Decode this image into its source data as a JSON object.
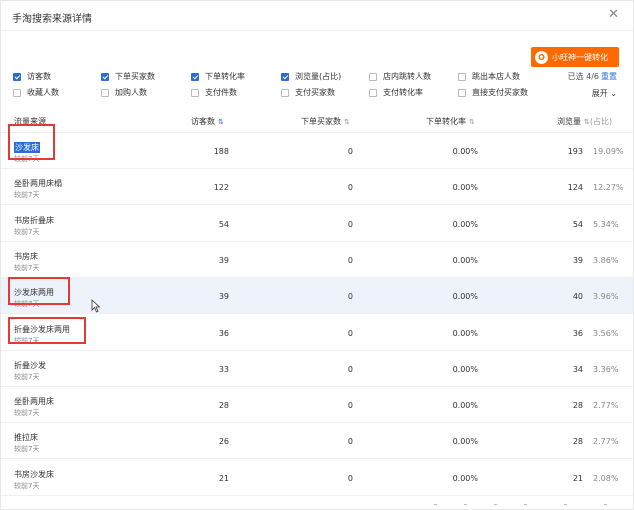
{
  "header": {
    "title": "手淘搜索来源详情",
    "close_icon": "close-icon"
  },
  "promo": {
    "label": "小旺神一键转化",
    "icon_char": "O"
  },
  "options": [
    {
      "label": "访客数",
      "checked": true
    },
    {
      "label": "下单买家数",
      "checked": true
    },
    {
      "label": "下单转化率",
      "checked": true
    },
    {
      "label": "浏览量(占比)",
      "checked": true
    },
    {
      "label": "店内跳转人数",
      "checked": false
    },
    {
      "label": "跳出本店人数",
      "checked": false
    },
    {
      "label": "收藏人数",
      "checked": false
    },
    {
      "label": "加购人数",
      "checked": false
    },
    {
      "label": "支付件数",
      "checked": false
    },
    {
      "label": "支付买家数",
      "checked": false
    },
    {
      "label": "支付转化率",
      "checked": false
    },
    {
      "label": "直接支付买家数",
      "checked": false
    }
  ],
  "selection": {
    "text": "已选 4/6",
    "reset": "重置",
    "expand": "展开"
  },
  "columns": {
    "source": "流量来源",
    "visitors": "访客数",
    "buyers": "下单买家数",
    "conv": "下单转化率",
    "pv": "浏览量",
    "pv_share": "(占比)"
  },
  "rows": [
    {
      "name": "沙发床",
      "sub": "较前7天",
      "visitors": "188",
      "buyers": "0",
      "conv": "0.00%",
      "pv": "193",
      "share": "19.09%"
    },
    {
      "name": "坐卧两用床榻",
      "sub": "较前7天",
      "visitors": "122",
      "buyers": "0",
      "conv": "0.00%",
      "pv": "124",
      "share": "12.27%"
    },
    {
      "name": "书房折叠床",
      "sub": "较前7天",
      "visitors": "54",
      "buyers": "0",
      "conv": "0.00%",
      "pv": "54",
      "share": "5.34%"
    },
    {
      "name": "书房床",
      "sub": "较前7天",
      "visitors": "39",
      "buyers": "0",
      "conv": "0.00%",
      "pv": "39",
      "share": "3.86%"
    },
    {
      "name": "沙发床两用",
      "sub": "较前7天",
      "visitors": "39",
      "buyers": "0",
      "conv": "0.00%",
      "pv": "40",
      "share": "3.96%"
    },
    {
      "name": "折叠沙发床两用",
      "sub": "较前7天",
      "visitors": "36",
      "buyers": "0",
      "conv": "0.00%",
      "pv": "36",
      "share": "3.56%"
    },
    {
      "name": "折叠沙发",
      "sub": "较前7天",
      "visitors": "33",
      "buyers": "0",
      "conv": "0.00%",
      "pv": "34",
      "share": "3.36%"
    },
    {
      "name": "坐卧两用床",
      "sub": "较前7天",
      "visitors": "28",
      "buyers": "0",
      "conv": "0.00%",
      "pv": "28",
      "share": "2.77%"
    },
    {
      "name": "推拉床",
      "sub": "较前7天",
      "visitors": "26",
      "buyers": "0",
      "conv": "0.00%",
      "pv": "28",
      "share": "2.77%"
    },
    {
      "name": "书房沙发床",
      "sub": "较前7天",
      "visitors": "21",
      "buyers": "0",
      "conv": "0.00%",
      "pv": "21",
      "share": "2.08%"
    }
  ],
  "colors": {
    "accent": "#2d6bd6",
    "promo": "#ff6a00",
    "annotation": "#e53935"
  }
}
